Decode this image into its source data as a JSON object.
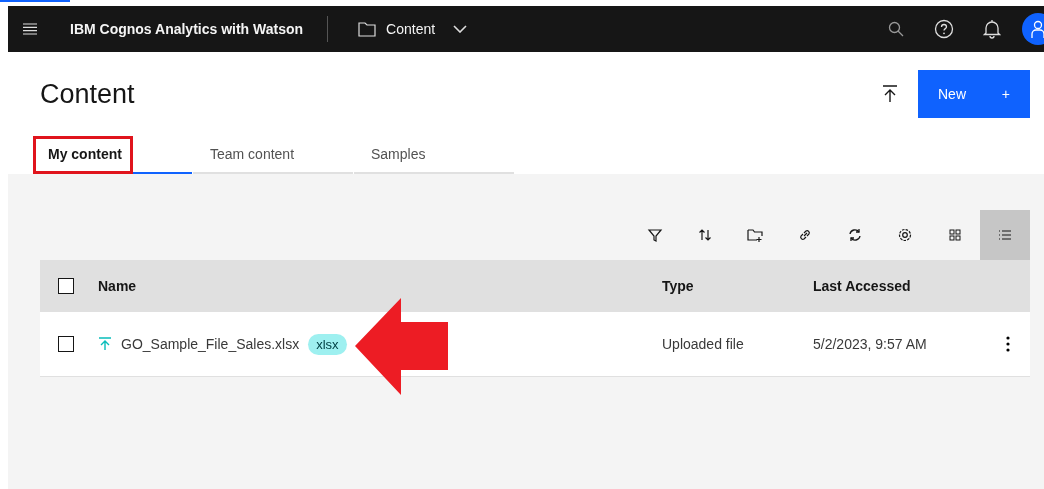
{
  "topbar": {
    "product": "IBM Cognos Analytics with Watson",
    "location": "Content"
  },
  "header": {
    "title": "Content",
    "new_button": "New",
    "new_icon": "+"
  },
  "tabs": [
    {
      "label": "My content",
      "selected": true,
      "highlighted": true
    },
    {
      "label": "Team content",
      "selected": false,
      "highlighted": false
    },
    {
      "label": "Samples",
      "selected": false,
      "highlighted": false
    }
  ],
  "toolbar": [
    {
      "kind": "filter",
      "selected": false
    },
    {
      "kind": "sort",
      "selected": false
    },
    {
      "kind": "new-folder",
      "selected": false
    },
    {
      "kind": "link",
      "selected": false
    },
    {
      "kind": "refresh",
      "selected": false
    },
    {
      "kind": "settings",
      "selected": false
    },
    {
      "kind": "grid-view",
      "selected": false
    },
    {
      "kind": "list-view",
      "selected": true
    }
  ],
  "table": {
    "columns": [
      "Name",
      "Type",
      "Last Accessed"
    ],
    "select_all_checked": false,
    "rows": [
      {
        "name": "GO_Sample_File_Sales.xlsx",
        "tag": "xlsx",
        "type": "Uploaded file",
        "last_accessed": "5/2/2023, 9:57 AM",
        "checked": false,
        "pointed": true
      }
    ]
  }
}
